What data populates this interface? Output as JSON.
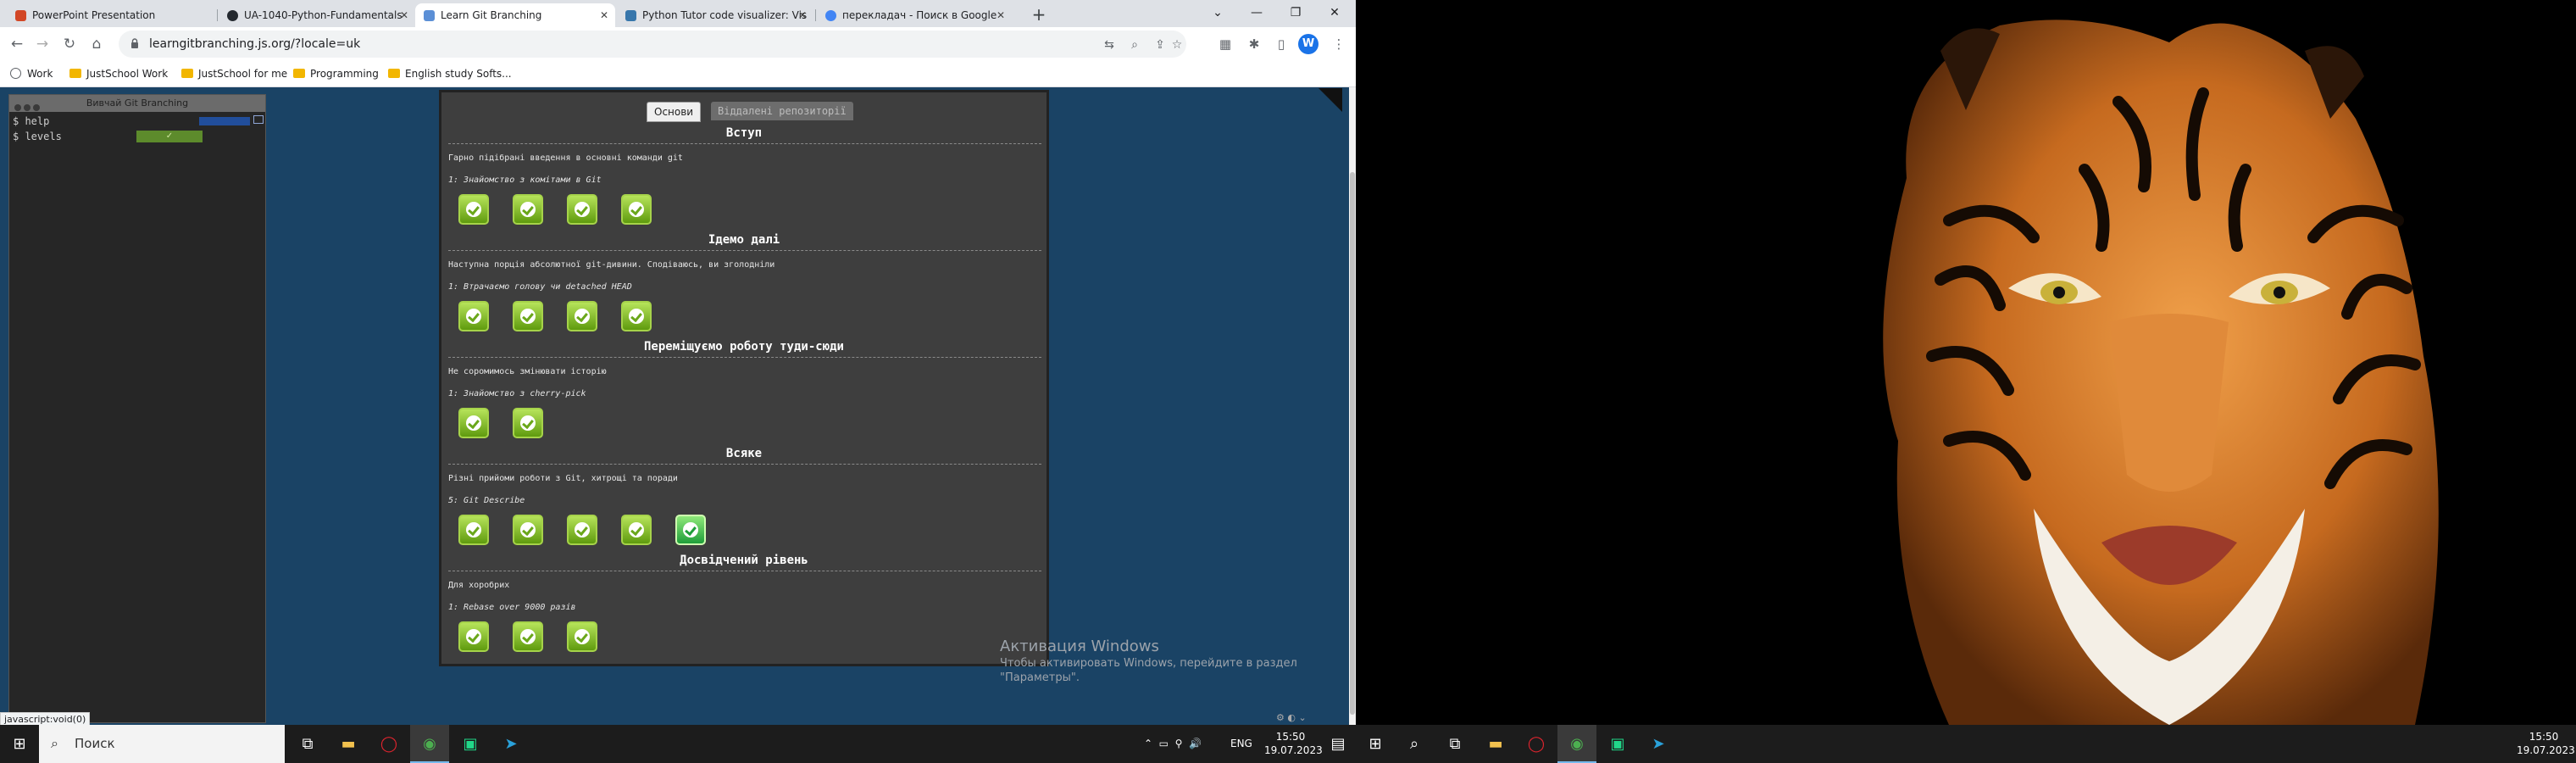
{
  "browser": {
    "tabs": [
      {
        "title": "PowerPoint Presentation",
        "color": "#d24726"
      },
      {
        "title": "UA-1040-Python-Fundamentals",
        "color": "#24292f"
      },
      {
        "title": "Learn Git Branching",
        "color": "#5b8fd6"
      },
      {
        "title": "Python Tutor code visualizer: Vis",
        "color": "#3776ab"
      },
      {
        "title": "перекладач - Поиск в Google",
        "color": "#4285f4"
      }
    ],
    "url": "learngitbranching.js.org/?locale=uk",
    "profile_initial": "W",
    "bookmarks": [
      "Work",
      "JustSchool Work",
      "JustSchool for me",
      "Programming",
      "English study Softs..."
    ],
    "status_url": "javascript:void(0)"
  },
  "terminal": {
    "title": "Вивчай Git Branching",
    "lines": [
      "$ help",
      "$ levels"
    ]
  },
  "levels_dialog": {
    "tabs": [
      "Основи",
      "Віддалені репозиторії"
    ],
    "sections": [
      {
        "title": "Вступ",
        "description": "Гарно підібрані введення в основні команди git",
        "current": "1: Знайомство з комітами в Git",
        "levels": 4,
        "selected": -1
      },
      {
        "title": "Ідемо далі",
        "description": "Наступна порція абсолютної git-дивини. Сподіваюсь, ви зголодніли",
        "current": "1: Втрачаємо голову чи detached HEAD",
        "levels": 4,
        "selected": -1
      },
      {
        "title": "Переміщуємо роботу туди-сюди",
        "description": "Не соромимось змінювати історію",
        "current": "1: Знайомство з cherry-pick",
        "levels": 2,
        "selected": -1
      },
      {
        "title": "Всяке",
        "description": "Різні прийоми роботи з Git, хитрощі та поради",
        "current": "5: Git Describe",
        "levels": 5,
        "selected": 4
      },
      {
        "title": "Досвідчений рівень",
        "description": "Для хоробрих",
        "current": "1: Rebase over 9000 разів",
        "levels": 3,
        "selected": -1
      }
    ]
  },
  "watermark": {
    "line1": "Активация Windows",
    "line2": "Чтобы активировать Windows, перейдите в раздел",
    "line3": "\"Параметры\"."
  },
  "taskbar": {
    "search_placeholder": "Поиск",
    "lang": "ENG",
    "time": "15:50",
    "date": "19.07.2023"
  }
}
